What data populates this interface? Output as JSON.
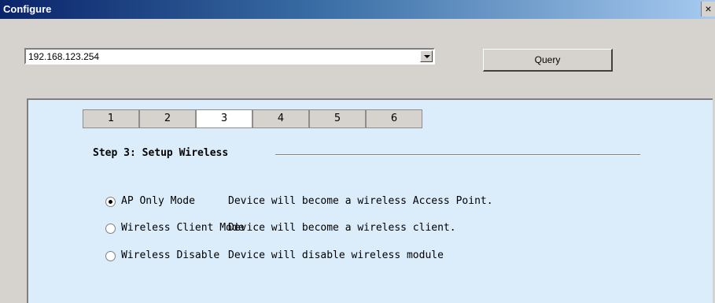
{
  "window": {
    "title": "Configure",
    "close_label": "×"
  },
  "ip_combo": {
    "value": "192.168.123.254"
  },
  "query_button": {
    "label": "Query"
  },
  "tabs": [
    {
      "label": "1",
      "active": false
    },
    {
      "label": "2",
      "active": false
    },
    {
      "label": "3",
      "active": true
    },
    {
      "label": "4",
      "active": false
    },
    {
      "label": "5",
      "active": false
    },
    {
      "label": "6",
      "active": false
    }
  ],
  "step": {
    "title": "Step 3: Setup Wireless"
  },
  "options": [
    {
      "label": "AP Only Mode",
      "description": "Device will become a wireless Access Point.",
      "checked": true
    },
    {
      "label": "Wireless Client Mode",
      "description": "Device will become a wireless client.",
      "checked": false
    },
    {
      "label": "Wireless Disable",
      "description": "Device will disable wireless module",
      "checked": false
    }
  ],
  "icons": {
    "close": "close-icon",
    "dropdown": "chevron-down-icon",
    "radio": "radio-button-icon"
  }
}
